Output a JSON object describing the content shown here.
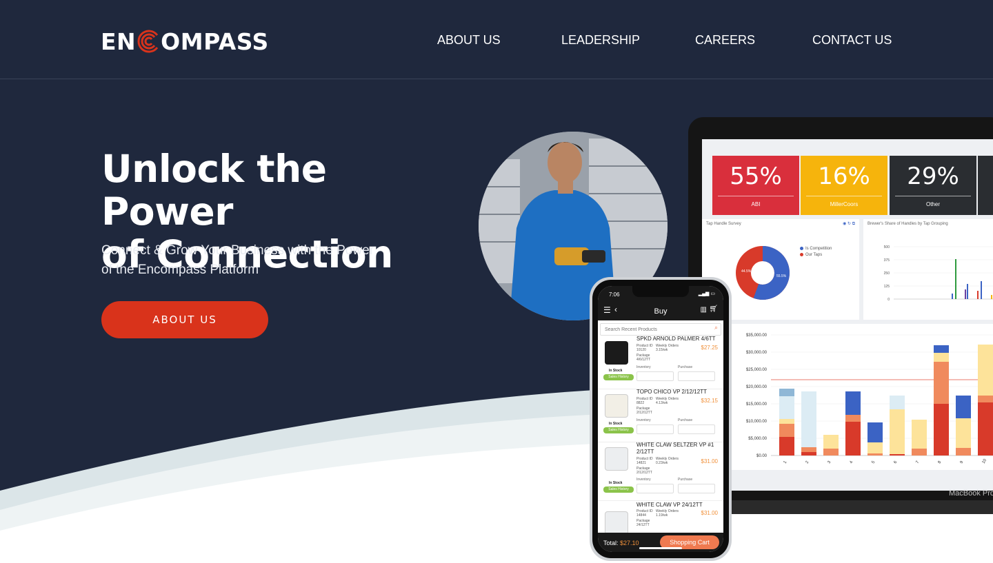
{
  "brand": {
    "logo_left": "EN",
    "logo_right": "OMPASS",
    "accent": "#d9331b",
    "navy": "#1f283d"
  },
  "nav": {
    "items": [
      {
        "label": "ABOUT US"
      },
      {
        "label": "LEADERSHIP"
      },
      {
        "label": "CAREERS"
      },
      {
        "label": "CONTACT US"
      }
    ]
  },
  "hero": {
    "title_line1": "Unlock the Power",
    "title_line2": "of Connection",
    "subtitle_line1": "Connect & Grow Your Business with the Power",
    "subtitle_line2": "of the Encompass Platform",
    "cta_label": "ABOUT US"
  },
  "laptop": {
    "label": "MacBook Pro",
    "tiles": [
      {
        "pct": "55%",
        "label": "ABI",
        "color": "#d92f3c"
      },
      {
        "pct": "16%",
        "label": "MillerCoors",
        "color": "#f6b40c"
      },
      {
        "pct": "29%",
        "label": "Other",
        "color": "#2a2d31"
      }
    ],
    "donut_panel": {
      "title": "Tap Handle Survey",
      "legend": [
        "Is Competition",
        "Our Taps"
      ],
      "values_pct": [
        55.5,
        44.5
      ],
      "labels": [
        "55.5%",
        "44.5%"
      ],
      "colors": [
        "#3b63c4",
        "#d83a2a"
      ]
    },
    "share_panel": {
      "title": "Brewer's Share of Handles by Tap Grouping",
      "ticks": [
        "500",
        "375",
        "250",
        "125",
        "0"
      ]
    },
    "bar_panel": {
      "y_ticks": [
        "$35,000.00",
        "$30,000.00",
        "$25,000.00",
        "$20,000.00",
        "$15,000.00",
        "$10,000.00",
        "$5,000.00",
        "$0.00"
      ],
      "x_ticks": [
        "1",
        "2",
        "3",
        "4",
        "5",
        "6",
        "7",
        "8",
        "9",
        "10"
      ]
    }
  },
  "phone": {
    "time": "7:06",
    "title": "Buy",
    "search_placeholder": "Search Recent Products",
    "product_id_label": "Product ID",
    "weekly_orders_label": "Weekly Orders",
    "package_label": "Package",
    "inventory_label": "Inventory",
    "purchase_label": "Purchase",
    "in_stock": "In Stock",
    "sales_history": "Sales History",
    "items": [
      {
        "name": "SPKD ARNOLD PALMER 4/6TT",
        "id": "10120",
        "weekly": "3.15/wk",
        "package": "4/6/12TT",
        "price": "$27.25"
      },
      {
        "name": "TOPO CHICO VP 2/12/12TT",
        "id": "8822",
        "weekly": "4.13/wk",
        "package": "2/12/12TT",
        "price": "$32.15"
      },
      {
        "name": "WHITE CLAW SELTZER VP #1 2/12TT",
        "id": "14821",
        "weekly": "0.23/wk",
        "package": "2/12/12TT",
        "price": "$31.00"
      },
      {
        "name": "WHITE CLAW VP 24/12TT",
        "id": "14844",
        "weekly": "1.19/wk",
        "package": "24/12TT",
        "price": "$31.00"
      }
    ],
    "total_label": "Total:",
    "total_value": "$27.10",
    "cart_label": "Shopping Cart"
  }
}
